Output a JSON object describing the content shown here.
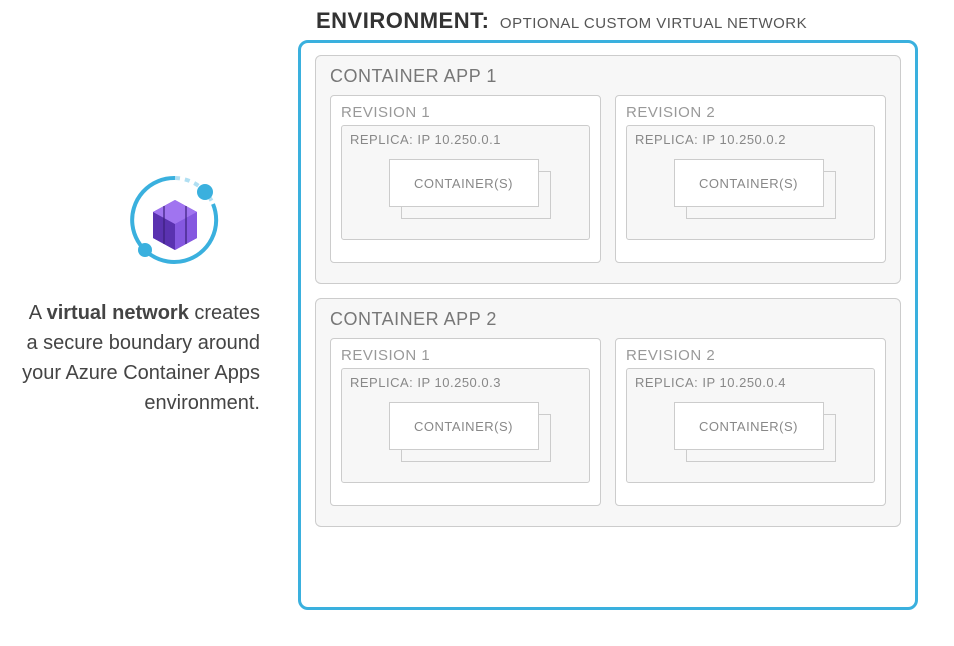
{
  "caption": {
    "prefix": "A ",
    "strong": "virtual network",
    "rest": " creates a secure boundary around your Azure Container Apps environment."
  },
  "env": {
    "label": "ENVIRONMENT:",
    "sub": "OPTIONAL CUSTOM VIRTUAL NETWORK"
  },
  "apps": [
    {
      "title": "CONTAINER APP 1",
      "revisions": [
        {
          "title": "REVISION 1",
          "replica": "REPLICA: IP 10.250.0.1",
          "container": "CONTAINER(S)"
        },
        {
          "title": "REVISION 2",
          "replica": "REPLICA: IP 10.250.0.2",
          "container": "CONTAINER(S)"
        }
      ]
    },
    {
      "title": "CONTAINER APP 2",
      "revisions": [
        {
          "title": "REVISION 1",
          "replica": "REPLICA: IP 10.250.0.3",
          "container": "CONTAINER(S)"
        },
        {
          "title": "REVISION 2",
          "replica": "REPLICA: IP 10.250.0.4",
          "container": "CONTAINER(S)"
        }
      ]
    }
  ]
}
